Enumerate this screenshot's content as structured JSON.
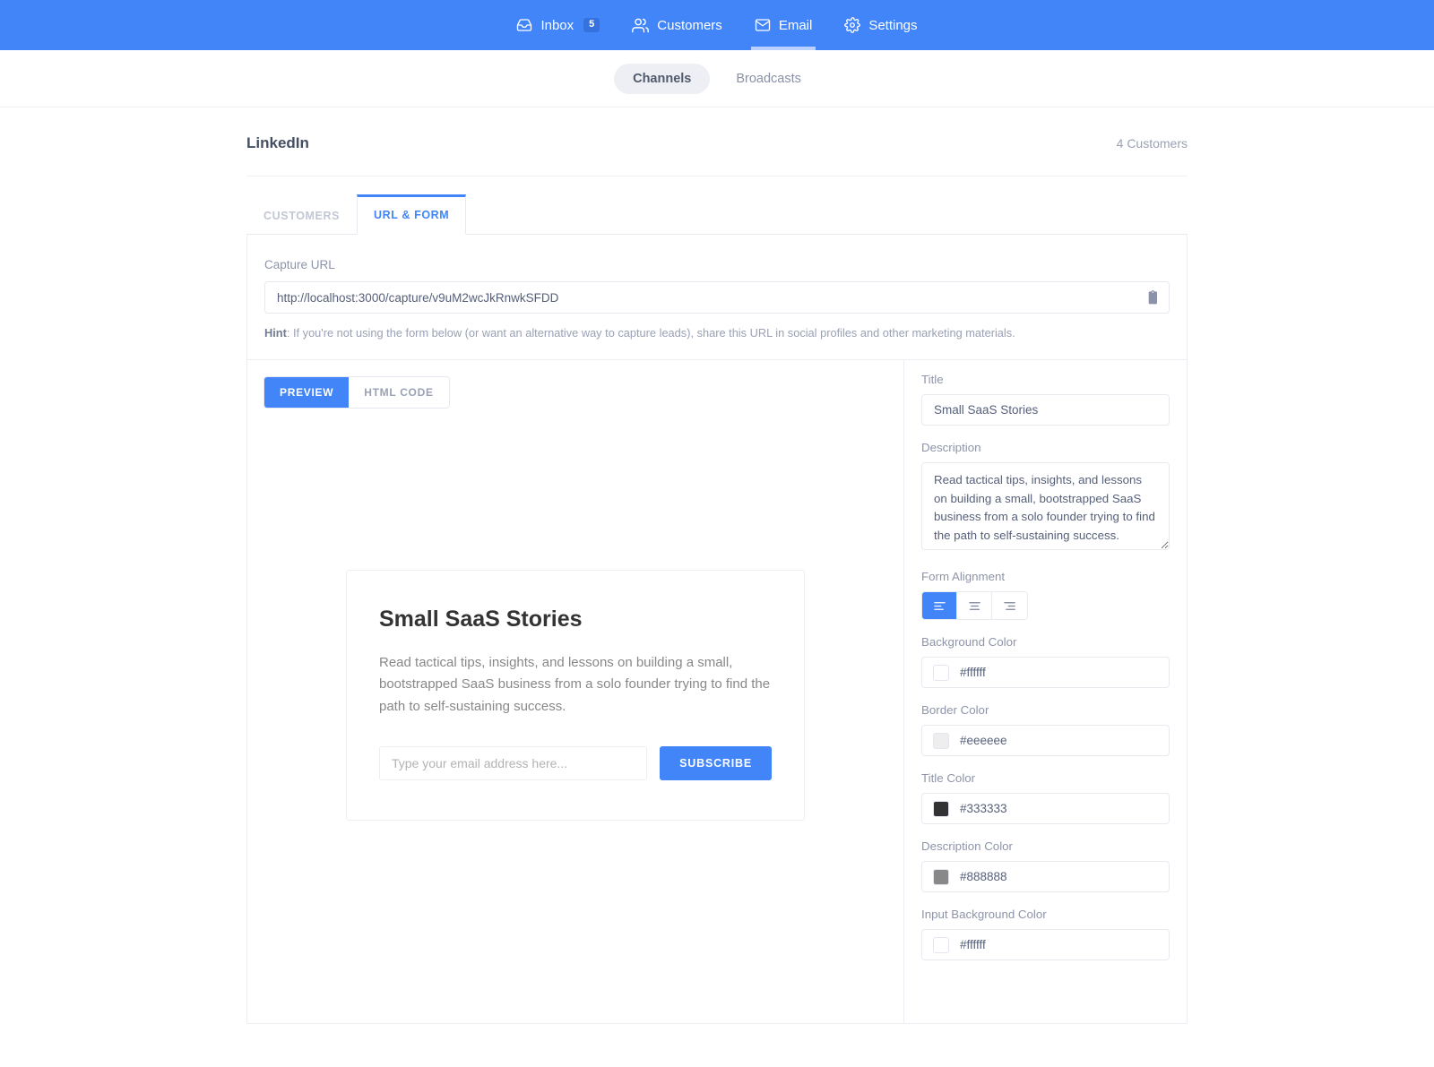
{
  "topnav": {
    "items": [
      {
        "label": "Inbox",
        "icon": "inbox-icon",
        "badge": "5",
        "active": false
      },
      {
        "label": "Customers",
        "icon": "people-icon",
        "badge": null,
        "active": false
      },
      {
        "label": "Email",
        "icon": "envelope-icon",
        "badge": null,
        "active": true
      },
      {
        "label": "Settings",
        "icon": "gear-icon",
        "badge": null,
        "active": false
      }
    ],
    "background": "#4285f8"
  },
  "subnav": {
    "items": [
      {
        "label": "Channels",
        "active": true
      },
      {
        "label": "Broadcasts",
        "active": false
      }
    ]
  },
  "page": {
    "title": "LinkedIn",
    "customer_count": "4 Customers"
  },
  "tabs": [
    {
      "label": "CUSTOMERS",
      "active": false
    },
    {
      "label": "URL & FORM",
      "active": true
    }
  ],
  "capture": {
    "label": "Capture URL",
    "url": "http://localhost:3000/capture/v9uM2wcJkRnwkSFDD",
    "copy_icon": "clipboard-icon",
    "hint_strong": "Hint",
    "hint_rest": ": If you're not using the form below (or want an alternative way to capture leads), share this URL in social profiles and other marketing materials."
  },
  "view_toggle": [
    {
      "label": "PREVIEW",
      "active": true
    },
    {
      "label": "HTML CODE",
      "active": false
    }
  ],
  "embed": {
    "title": "Small SaaS Stories",
    "description": "Read tactical tips, insights, and lessons on building a small, bootstrapped SaaS business from a solo founder trying to find the path to self-sustaining success.",
    "email_placeholder": "Type your email address here...",
    "email_value": "",
    "subscribe_label": "SUBSCRIBE"
  },
  "settings": {
    "title": {
      "label": "Title",
      "value": "Small SaaS Stories"
    },
    "description": {
      "label": "Description",
      "value": "Read tactical tips, insights, and lessons on building a small, bootstrapped SaaS business from a solo founder trying to find the path to self-sustaining success."
    },
    "form_alignment": {
      "label": "Form Alignment",
      "options": [
        {
          "icon": "align-left-icon",
          "active": true
        },
        {
          "icon": "align-center-icon",
          "active": false
        },
        {
          "icon": "align-right-icon",
          "active": false
        }
      ]
    },
    "colors": [
      {
        "label": "Background Color",
        "value": "#ffffff"
      },
      {
        "label": "Border Color",
        "value": "#eeeeee"
      },
      {
        "label": "Title Color",
        "value": "#333333"
      },
      {
        "label": "Description Color",
        "value": "#888888"
      },
      {
        "label": "Input Background Color",
        "value": "#ffffff"
      }
    ]
  }
}
